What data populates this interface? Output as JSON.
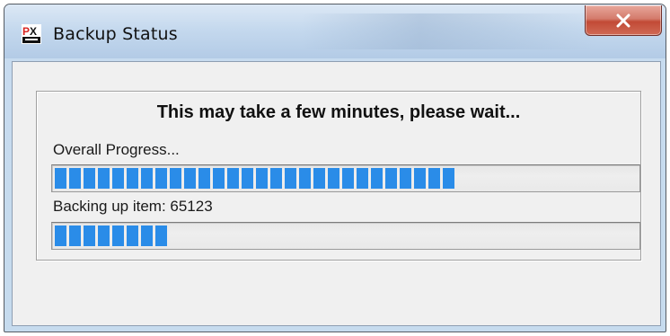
{
  "window": {
    "title": "Backup Status",
    "icon": "pdx-app-icon",
    "close_icon": "close-icon"
  },
  "dialog": {
    "heading": "This may take a few minutes, please wait...",
    "overall_label": "Overall Progress...",
    "overall_progress": 0.7,
    "item_label": "Backing up item: 65123",
    "item_progress": 0.22
  },
  "colors": {
    "progress_fill": "#2a8ce8",
    "close_button": "#c24a36"
  }
}
